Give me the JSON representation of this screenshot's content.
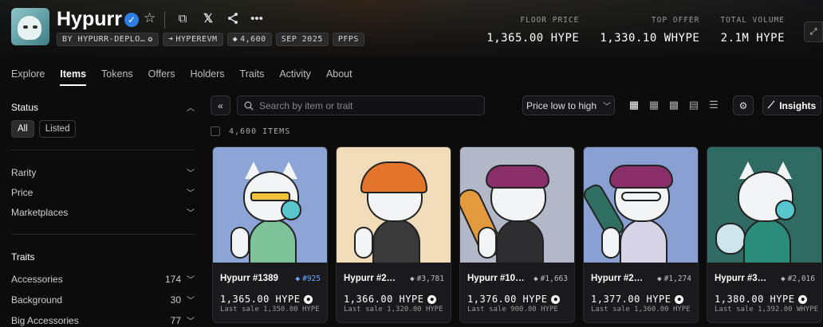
{
  "collection": {
    "name": "Hypurr",
    "chips": [
      "BY HYPURR-DEPLO…",
      "HYPEREVM",
      "4,600",
      "SEP 2025",
      "PFPS"
    ]
  },
  "stats": [
    {
      "label": "FLOOR PRICE",
      "value": "1,365.00 HYPE"
    },
    {
      "label": "TOP OFFER",
      "value": "1,330.10 WHYPE"
    },
    {
      "label": "TOTAL VOLUME",
      "value": "2.1M HYPE"
    }
  ],
  "nav": [
    "Explore",
    "Items",
    "Tokens",
    "Offers",
    "Holders",
    "Traits",
    "Activity",
    "About"
  ],
  "sidebar": {
    "status_title": "Status",
    "status_buttons": [
      "All",
      "Listed"
    ],
    "filters": [
      "Rarity",
      "Price",
      "Marketplaces"
    ],
    "traits_title": "Traits",
    "traits": [
      {
        "name": "Accessories",
        "count": "174"
      },
      {
        "name": "Background",
        "count": "30"
      },
      {
        "name": "Big Accessories",
        "count": "77"
      }
    ]
  },
  "toolbar": {
    "search_placeholder": "Search by item or trait",
    "sort_label": "Price low to high",
    "insights_label": "Insights"
  },
  "items_count": "4,600 ITEMS",
  "cards": [
    {
      "name": "Hypurr #1389",
      "rank": "#925",
      "price": "1,365.00 HYPE",
      "last": "Last sale 1,350.00 HYPE",
      "bg": "#8da4d6"
    },
    {
      "name": "Hypurr #2…",
      "rank": "#3,781",
      "price": "1,366.00 HYPE",
      "last": "Last sale 1,320.00 HYPE",
      "bg": "#f0dcb8"
    },
    {
      "name": "Hypurr #10…",
      "rank": "#1,663",
      "price": "1,376.00 HYPE",
      "last": "Last sale 900.00 HYPE",
      "bg": "#b2b8c7"
    },
    {
      "name": "Hypurr #2…",
      "rank": "#1,274",
      "price": "1,377.00 HYPE",
      "last": "Last sale 1,360.00 HYPE",
      "bg": "#8aa0d2"
    },
    {
      "name": "Hypurr #3…",
      "rank": "#2,016",
      "price": "1,380.00 HYPE",
      "last": "Last sale 1,392.00 WHYPE",
      "bg": "#2f6b63"
    }
  ]
}
